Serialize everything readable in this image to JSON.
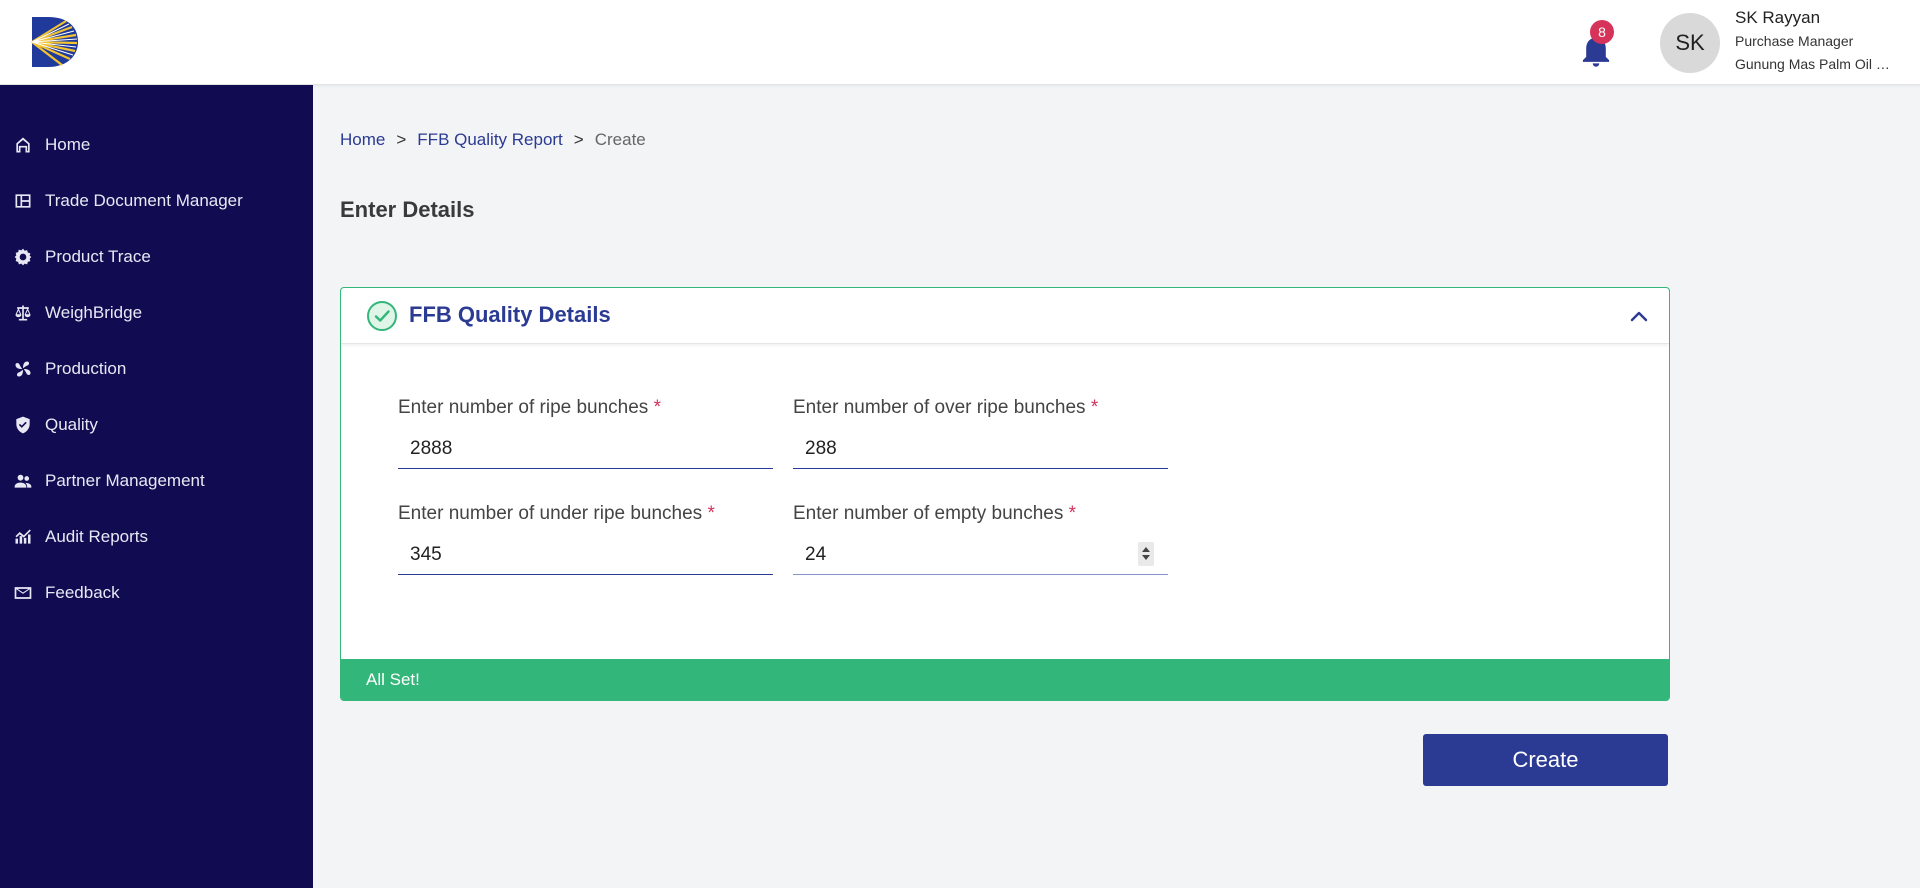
{
  "header": {
    "notifications_count": "8",
    "avatar_initials": "SK",
    "user_name": "SK Rayyan",
    "user_role": "Purchase Manager",
    "user_org": "Gunung Mas Palm Oil Mills"
  },
  "sidebar": {
    "items": [
      {
        "label": "Home",
        "icon": "home-icon"
      },
      {
        "label": "Trade Document Manager",
        "icon": "document-grid-icon"
      },
      {
        "label": "Product Trace",
        "icon": "gear-icon"
      },
      {
        "label": "WeighBridge",
        "icon": "scale-icon"
      },
      {
        "label": "Production",
        "icon": "fan-icon"
      },
      {
        "label": "Quality",
        "icon": "shield-check-icon"
      },
      {
        "label": "Partner Management",
        "icon": "people-icon"
      },
      {
        "label": "Audit Reports",
        "icon": "chart-icon"
      },
      {
        "label": "Feedback",
        "icon": "mail-icon"
      }
    ]
  },
  "breadcrumb": {
    "home": "Home",
    "report": "FFB Quality Report",
    "current": "Create",
    "separator": ">"
  },
  "page_title": "Enter Details",
  "card": {
    "title": "FFB Quality Details",
    "fields": {
      "ripe": {
        "label": "Enter number of ripe bunches",
        "value": "2888"
      },
      "over_ripe": {
        "label": "Enter number of over ripe bunches",
        "value": "288"
      },
      "under_ripe": {
        "label": "Enter number of under ripe bunches",
        "value": "345"
      },
      "empty": {
        "label": "Enter number of empty bunches",
        "value": "24"
      }
    },
    "required_mark": "*",
    "status": "All Set!"
  },
  "create_label": "Create",
  "colors": {
    "sidebar_bg": "#110c52",
    "primary": "#2b3a92",
    "success": "#33b679",
    "badge": "#d6335a"
  }
}
